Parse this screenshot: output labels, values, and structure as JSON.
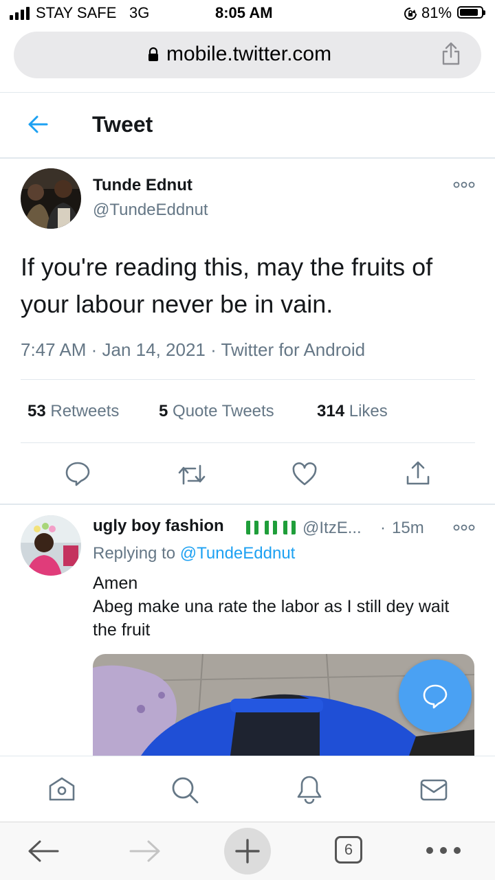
{
  "status_bar": {
    "carrier": "STAY SAFE",
    "network": "3G",
    "time": "8:05 AM",
    "battery": "81%",
    "battery_level": 0.81
  },
  "browser": {
    "url": "mobile.twitter.com",
    "tab_count": "6"
  },
  "header": {
    "title": "Tweet"
  },
  "tweet": {
    "author_name": "Tunde Ednut",
    "author_handle": "@TundeEddnut",
    "text": "If you're reading this, may the fruits of your labour never be in vain.",
    "time": "7:47 AM",
    "date": "Jan 14, 2021",
    "source": "Twitter for Android",
    "retweets_count": "53",
    "retweets_label": "Retweets",
    "quotes_count": "5",
    "quotes_label": "Quote Tweets",
    "likes_count": "314",
    "likes_label": "Likes"
  },
  "reply": {
    "author_name": "ugly boy fashion",
    "author_handle": "@ItzE...",
    "age": "15m",
    "replying_label": "Replying to",
    "replying_handle": "@TundeEddnut",
    "line1": "Amen",
    "line2": "Abeg make una rate the labor as I still dey wait the fruit"
  },
  "colors": {
    "accent": "#1da1f2",
    "text_primary": "#14171a",
    "text_secondary": "#657786",
    "divider": "#e1e8ed",
    "flag_green": "#1f9e3a"
  },
  "icons": {
    "back": "arrow-left-icon",
    "more": "more-dots-icon",
    "reply": "reply-icon",
    "retweet": "retweet-icon",
    "like": "heart-icon",
    "share": "share-icon",
    "compose": "compose-reply-icon",
    "home": "home-icon",
    "search": "search-icon",
    "notifications": "bell-icon",
    "messages": "mail-icon"
  }
}
